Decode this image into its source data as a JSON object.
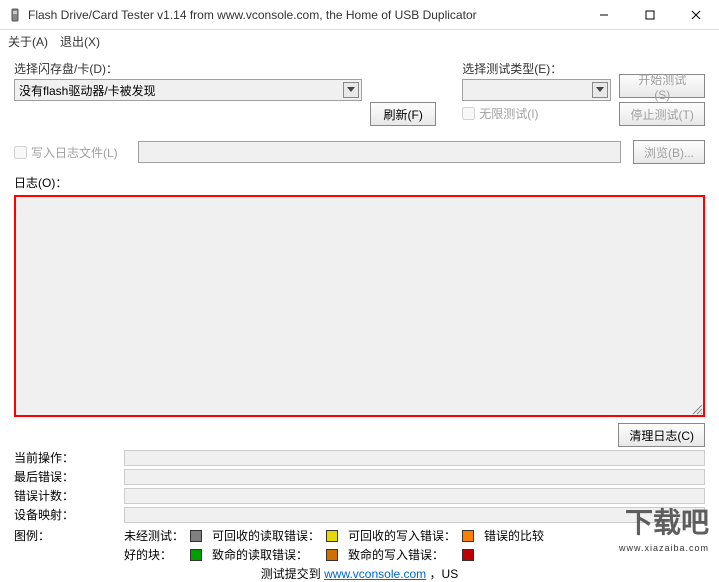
{
  "window": {
    "title": "Flash Drive/Card Tester v1.14 from www.vconsole.com, the Home of USB Duplicator"
  },
  "menu": {
    "about": "关于(A)",
    "exit": "退出(X)"
  },
  "labels": {
    "select_drive": "选择闪存盘/卡(D)：",
    "select_test_type": "选择测试类型(E)：",
    "drive_none": "没有flash驱动器/卡被发现",
    "unlimited_test": "无限测试(I)",
    "write_log_file": "写入日志文件(L)",
    "log": "日志(O)：",
    "current_op": "当前操作：",
    "last_error": "最后错误：",
    "error_count": "错误计数：",
    "device_map": "设备映射：",
    "legend": "图例："
  },
  "buttons": {
    "refresh": "刷新(F)",
    "start_test": "开始测试(S)",
    "stop_test": "停止测试(T)",
    "browse": "浏览(B)...",
    "clear_log": "清理日志(C)"
  },
  "legend_items": {
    "untested": "未经测试：",
    "good": "好的块：",
    "recov_read": "可回收的读取错误：",
    "fatal_read": "致命的读取错误：",
    "recov_write": "可回收的写入错误：",
    "fatal_write": "致命的写入错误：",
    "compare": "错误的比较"
  },
  "colors": {
    "untested": "#808080",
    "good": "#00a000",
    "recov_read": "#e6d800",
    "fatal_read": "#d07000",
    "recov_write": "#ff8000",
    "fatal_write": "#c00000",
    "compare": "#6080d0"
  },
  "footer": {
    "prefix": "测试提交到  ",
    "link_text": "www.vconsole.com",
    "suffix": "，US"
  },
  "watermark": {
    "main": "下载吧",
    "sub": "www.xiazaiba.com"
  }
}
